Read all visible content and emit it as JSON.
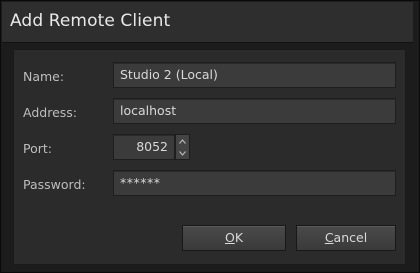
{
  "dialog": {
    "title": "Add Remote Client"
  },
  "form": {
    "name_label": "Name:",
    "name_value": "Studio 2 (Local)",
    "address_label": "Address:",
    "address_value": "localhost",
    "port_label": "Port:",
    "port_value": "8052",
    "password_label": "Password:",
    "password_value": "******"
  },
  "buttons": {
    "ok_mnemonic": "O",
    "ok_rest": "K",
    "cancel_mnemonic": "C",
    "cancel_rest": "ancel"
  },
  "icons": {
    "spin_up": "chevron-up-icon",
    "spin_down": "chevron-down-icon"
  },
  "colors": {
    "background": "#1c1c1c",
    "panel": "#2b2b2b",
    "field": "#3b3b3b",
    "text": "#d8d8d8"
  }
}
